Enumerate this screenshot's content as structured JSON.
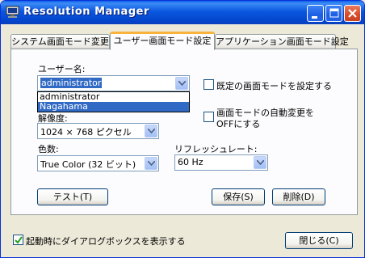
{
  "window": {
    "title": "Resolution Manager"
  },
  "tabs": [
    {
      "label": "システム画面モード変更"
    },
    {
      "label": "ユーザー画面モード設定"
    },
    {
      "label": "アプリケーション画面モード設定"
    }
  ],
  "user": {
    "label": "ユーザー名:",
    "value": "administrator",
    "options": [
      "administrator",
      "Nagahama"
    ]
  },
  "resolution": {
    "label": "解像度:",
    "value": "1024 × 768 ピクセル"
  },
  "color": {
    "label": "色数:",
    "value": "True Color (32 ビット)"
  },
  "refresh": {
    "label": "リフレッシュレート:",
    "value": "60 Hz"
  },
  "checkboxes": {
    "default_mode": "既定の画面モードを設定する",
    "auto_off_line1": "画面モードの自動変更を",
    "auto_off_line2": "OFFにする",
    "show_dialog": "起動時にダイアログボックスを表示する"
  },
  "buttons": {
    "test": "テスト(T)",
    "save": "保存(S)",
    "delete": "削除(D)",
    "close": "閉じる(C)"
  }
}
